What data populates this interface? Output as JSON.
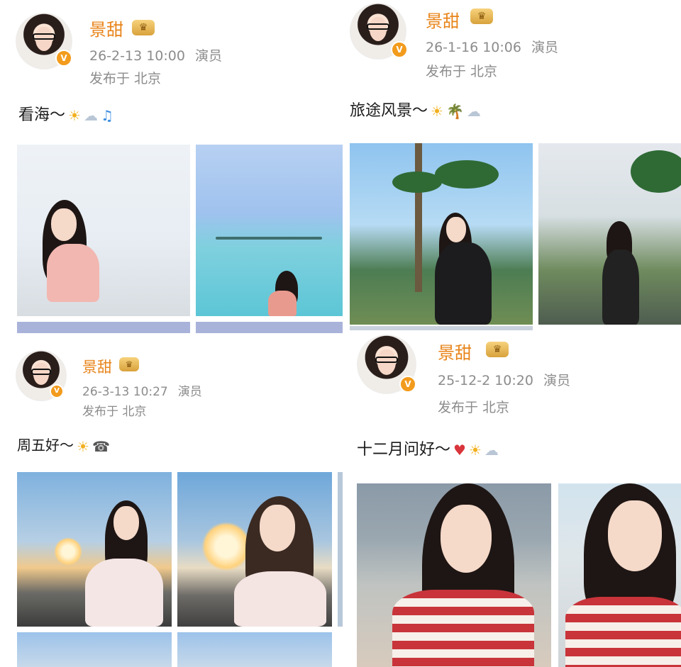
{
  "posts": [
    {
      "name": "景甜",
      "date": "26-2-13 10:00",
      "role": "演员",
      "location": "发布于 北京",
      "text": "看海～",
      "emojis": [
        "☀",
        "☁",
        "♫"
      ]
    },
    {
      "name": "景甜",
      "date": "26-1-16 10:06",
      "role": "演员",
      "location": "发布于 北京",
      "text": "旅途风景～",
      "emojis": [
        "☀",
        "🌴",
        "☁"
      ]
    },
    {
      "name": "景甜",
      "date": "26-3-13 10:27",
      "role": "演员",
      "location": "发布于 北京",
      "text": "周五好～",
      "emojis": [
        "☀",
        "☎"
      ]
    },
    {
      "name": "景甜",
      "date": "25-12-2 10:20",
      "role": "演员",
      "location": "发布于 北京",
      "text": "十二月问好～",
      "emojis": [
        "♥",
        "☀",
        "☁"
      ]
    }
  ],
  "colors": {
    "name": "#e8841a",
    "meta": "#8c8c8c",
    "badge": "#f29b1d"
  },
  "icons": {
    "verified": "verified-badge-icon",
    "crown": "vip-crown-icon"
  }
}
